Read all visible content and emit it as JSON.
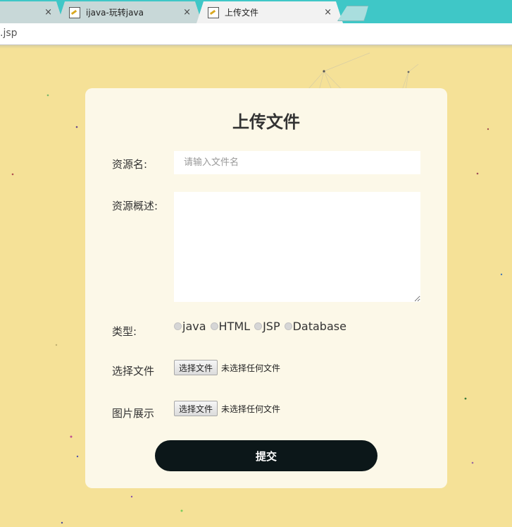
{
  "browser": {
    "tabs": [
      {
        "title": "",
        "active": false
      },
      {
        "title": "ijava-玩转java",
        "active": false
      },
      {
        "title": "上传文件",
        "active": true
      }
    ],
    "close_glyph": "×",
    "url": ".jsp"
  },
  "form": {
    "title": "上传文件",
    "name_label": "资源名:",
    "name_placeholder": "请输入文件名",
    "desc_label": "资源概述:",
    "type_label": "类型:",
    "type_options": [
      "java",
      "HTML",
      "JSP",
      "Database"
    ],
    "file_label": "选择文件",
    "image_label": "图片展示",
    "file_button": "选择文件",
    "no_file_text": "未选择任何文件",
    "submit_label": "提交"
  },
  "colors": {
    "tabbar": "#3fc7c7",
    "page_background": "#f5e197",
    "card_background": "#fcf8e8",
    "submit_background": "#0c1719"
  },
  "icons": {
    "tab_favicon": "page-icon",
    "tab_close": "close-icon",
    "radio": "radio-unchecked-icon"
  }
}
